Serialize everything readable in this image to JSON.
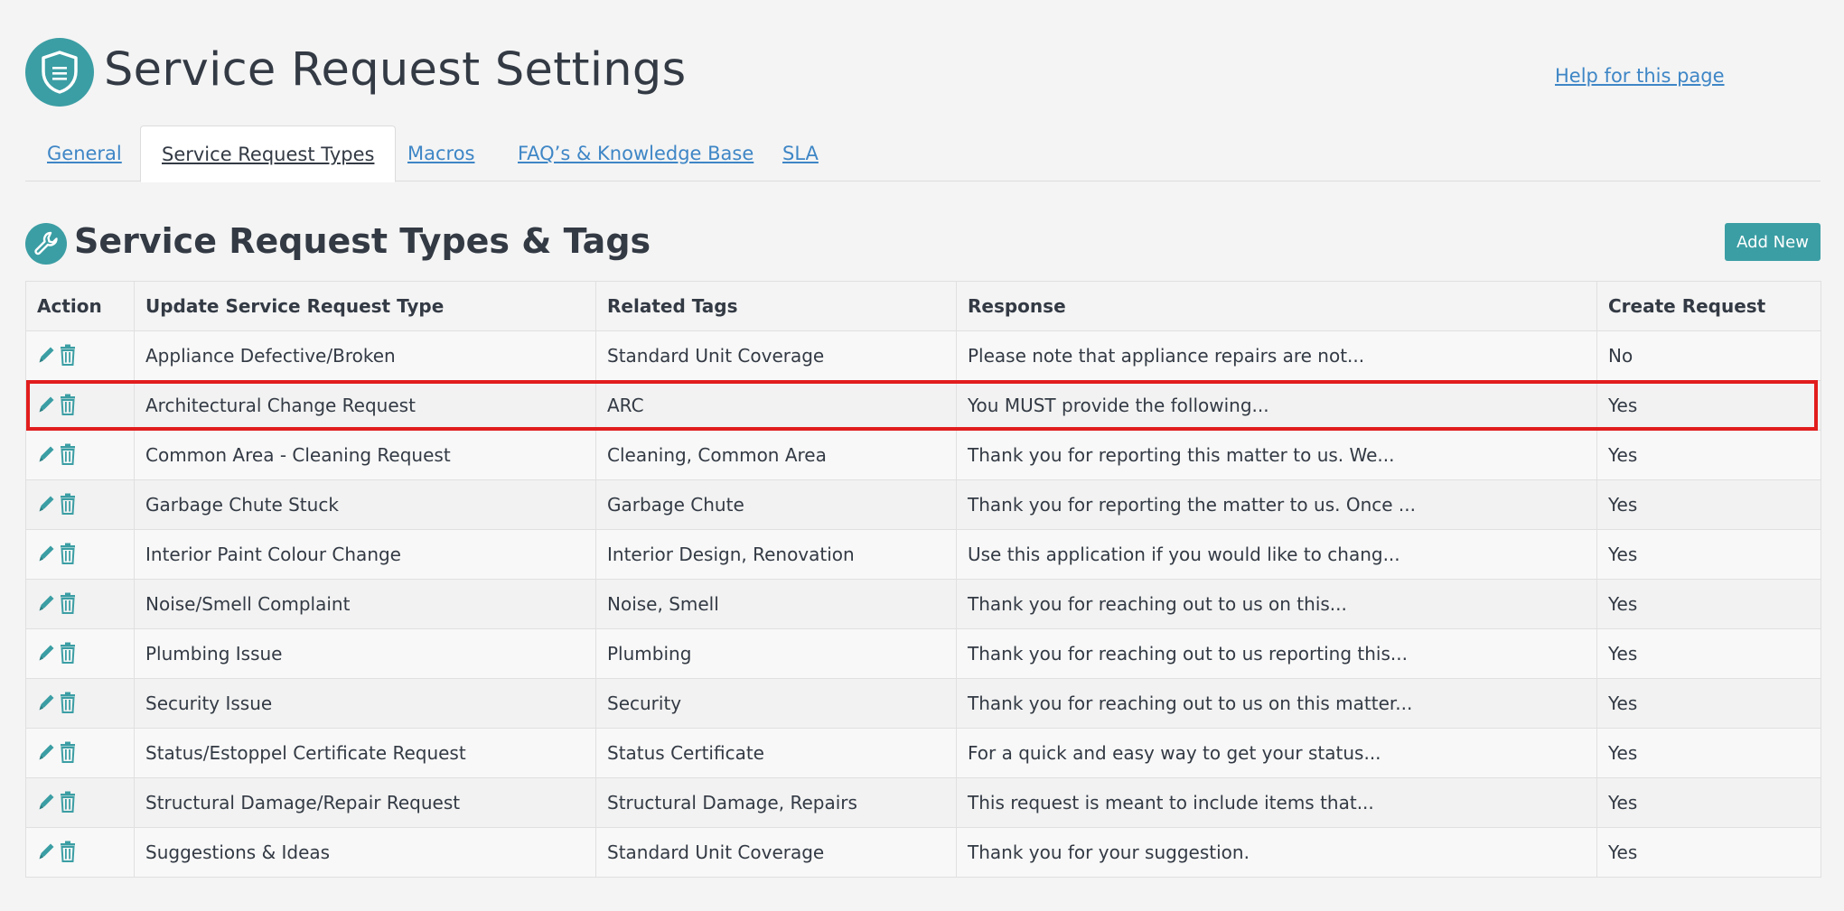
{
  "header": {
    "title": "Service Request Settings",
    "help_link": "Help for this page",
    "icon": "shield-icon"
  },
  "tabs": [
    {
      "label": "General",
      "active": false
    },
    {
      "label": "Service Request Types",
      "active": true
    },
    {
      "label": "Macros",
      "active": false
    },
    {
      "label": "FAQ’s & Knowledge Base",
      "active": false
    },
    {
      "label": "SLA",
      "active": false
    }
  ],
  "section": {
    "title": "Service Request Types & Tags",
    "icon": "wrench-icon",
    "add_new_label": "Add New"
  },
  "table": {
    "columns": [
      "Action",
      "Update Service Request Type",
      "Related Tags",
      "Response",
      "Create Request"
    ],
    "rows": [
      {
        "type": "Appliance Defective/Broken",
        "tags": "Standard Unit Coverage",
        "response": "Please note that appliance repairs are not...",
        "create": "No"
      },
      {
        "type": "Architectural Change Request",
        "tags": "ARC",
        "response": "You MUST provide the following...",
        "create": "Yes"
      },
      {
        "type": "Common Area - Cleaning Request",
        "tags": "Cleaning, Common Area",
        "response": "Thank you for reporting this matter to us. We...",
        "create": "Yes"
      },
      {
        "type": "Garbage Chute Stuck",
        "tags": "Garbage Chute",
        "response": "Thank you for reporting the matter to us. Once ...",
        "create": "Yes"
      },
      {
        "type": "Interior Paint Colour Change",
        "tags": "Interior Design, Renovation",
        "response": "Use this application if you would like to chang...",
        "create": "Yes"
      },
      {
        "type": "Noise/Smell Complaint",
        "tags": "Noise, Smell",
        "response": "Thank you for reaching out to us on this...",
        "create": "Yes"
      },
      {
        "type": "Plumbing Issue",
        "tags": "Plumbing",
        "response": "Thank you for reaching out to us reporting this...",
        "create": "Yes"
      },
      {
        "type": "Security Issue",
        "tags": "Security",
        "response": "Thank you for reaching out to us on this matter...",
        "create": "Yes"
      },
      {
        "type": "Status/Estoppel Certificate Request",
        "tags": "Status Certificate",
        "response": "For a quick and easy way to get your status...",
        "create": "Yes"
      },
      {
        "type": "Structural Damage/Repair Request",
        "tags": "Structural Damage, Repairs",
        "response": "This request is meant to include items that...",
        "create": "Yes"
      },
      {
        "type": "Suggestions & Ideas",
        "tags": "Standard Unit Coverage",
        "response": "Thank you for your suggestion.",
        "create": "Yes"
      }
    ],
    "highlighted_row": 1
  },
  "colors": {
    "accent": "#3b9ea4",
    "link": "#3e86c6",
    "highlight": "#e11d1d",
    "text": "#333a44"
  }
}
